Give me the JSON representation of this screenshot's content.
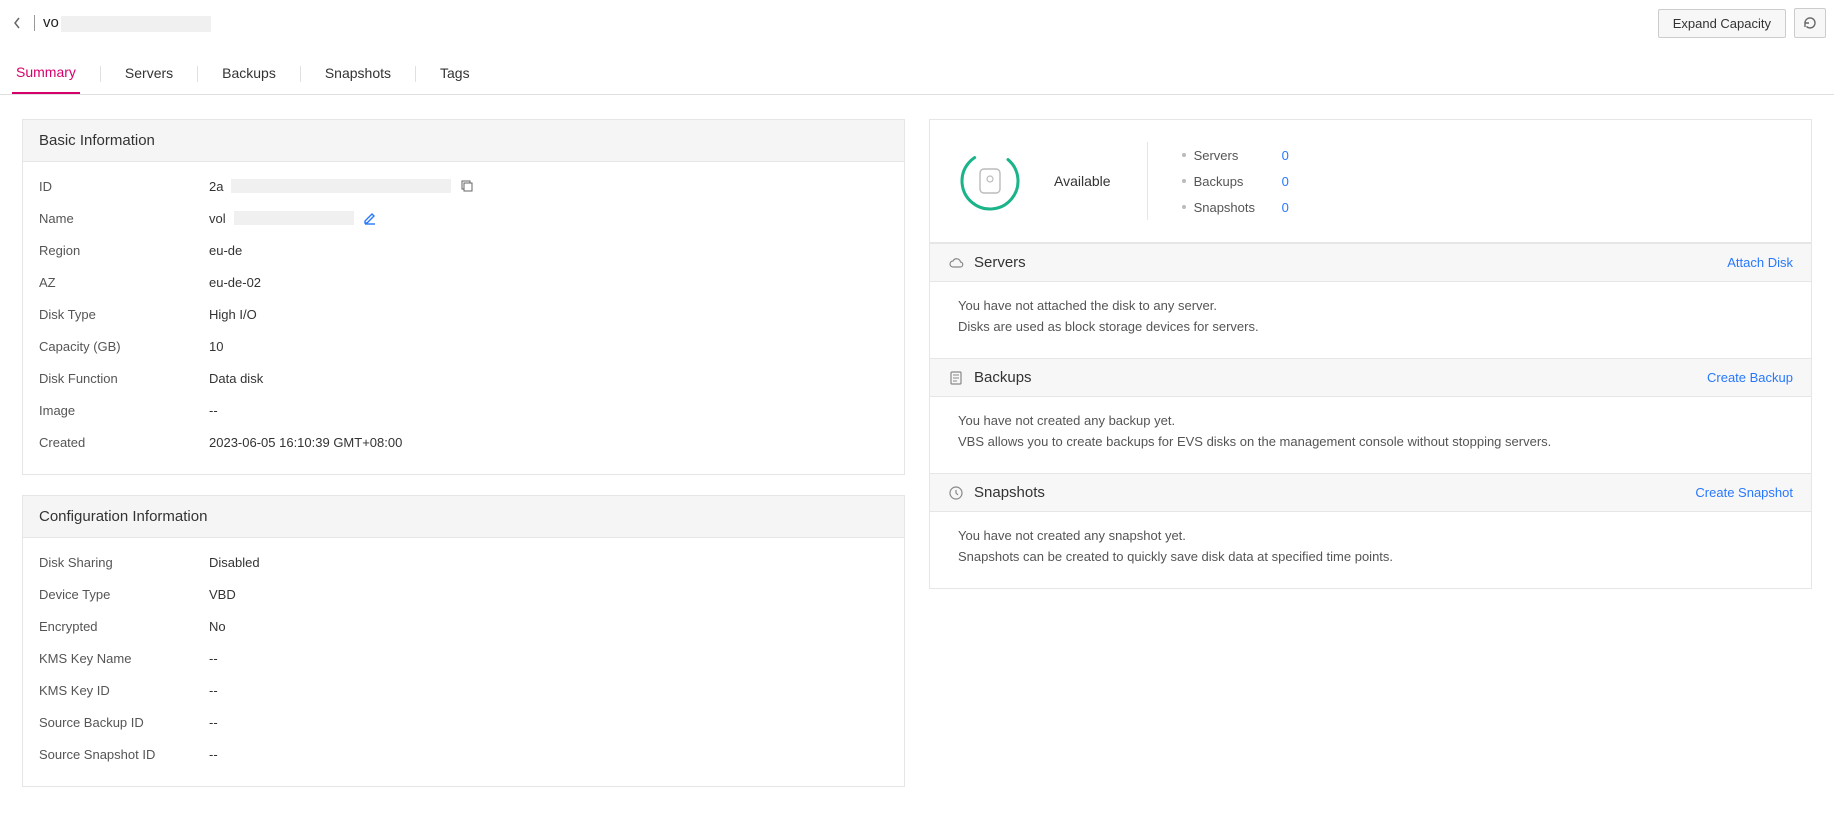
{
  "header": {
    "title_prefix": "vo",
    "expand_capacity": "Expand Capacity"
  },
  "tabs": [
    "Summary",
    "Servers",
    "Backups",
    "Snapshots",
    "Tags"
  ],
  "basic_info": {
    "title": "Basic Information",
    "rows": {
      "id_label": "ID",
      "id_value": "2a",
      "name_label": "Name",
      "name_value": "vol",
      "region_label": "Region",
      "region_value": "eu-de",
      "az_label": "AZ",
      "az_value": "eu-de-02",
      "disk_type_label": "Disk Type",
      "disk_type_value": "High I/O",
      "capacity_label": "Capacity (GB)",
      "capacity_value": "10",
      "disk_function_label": "Disk Function",
      "disk_function_value": "Data disk",
      "image_label": "Image",
      "image_value": "--",
      "created_label": "Created",
      "created_value": "2023-06-05 16:10:39 GMT+08:00"
    }
  },
  "config_info": {
    "title": "Configuration Information",
    "rows": {
      "sharing_label": "Disk Sharing",
      "sharing_value": "Disabled",
      "device_label": "Device Type",
      "device_value": "VBD",
      "encrypted_label": "Encrypted",
      "encrypted_value": "No",
      "kms_name_label": "KMS Key Name",
      "kms_name_value": "--",
      "kms_id_label": "KMS Key ID",
      "kms_id_value": "--",
      "src_backup_label": "Source Backup ID",
      "src_backup_value": "--",
      "src_snapshot_label": "Source Snapshot ID",
      "src_snapshot_value": "--"
    }
  },
  "status": {
    "state": "Available",
    "counts": {
      "servers_label": "Servers",
      "servers_value": "0",
      "backups_label": "Backups",
      "backups_value": "0",
      "snapshots_label": "Snapshots",
      "snapshots_value": "0"
    }
  },
  "sections": {
    "servers": {
      "title": "Servers",
      "action": "Attach Disk",
      "line1": "You have not attached the disk to any server.",
      "line2": "Disks are used as block storage devices for servers."
    },
    "backups": {
      "title": "Backups",
      "action": "Create Backup",
      "line1": "You have not created any backup yet.",
      "line2": "VBS allows you to create backups for EVS disks on the management console without stopping servers."
    },
    "snapshots": {
      "title": "Snapshots",
      "action": "Create Snapshot",
      "line1": "You have not created any snapshot yet.",
      "line2": "Snapshots can be created to quickly save disk data at specified time points."
    }
  }
}
